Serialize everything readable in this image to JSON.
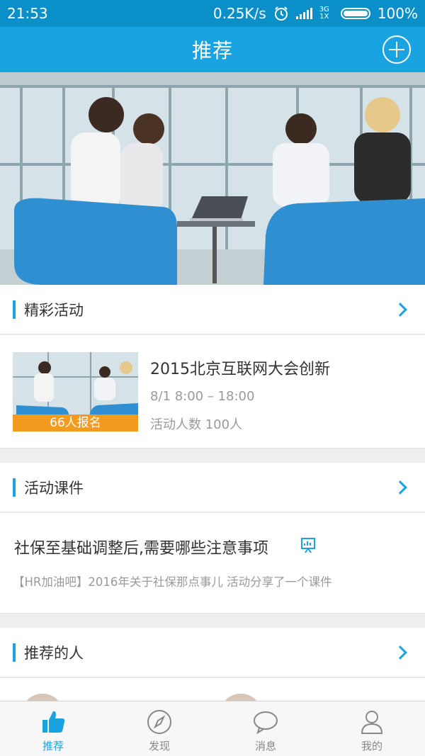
{
  "status_bar": {
    "time": "21:53",
    "speed": "0.25K/s",
    "network_top": "3G",
    "network_bottom": "1X",
    "battery": "100%"
  },
  "header": {
    "title": "推荐",
    "add_icon": "plus-circle-icon"
  },
  "sections": {
    "activities": {
      "title": "精彩活动"
    },
    "courseware": {
      "title": "活动课件"
    },
    "people": {
      "title": "推荐的人"
    }
  },
  "activity": {
    "title": "2015北京互联网大会创新",
    "time": "8/1  8:00 – 18:00",
    "count": "活动人数  100人",
    "badge": "66人报名"
  },
  "courseware_item": {
    "title": "社保至基础调整后,需要哪些注意事项",
    "desc": "【HR加油吧】2016年关于社保那点事儿  活动分享了一个课件",
    "icon": "presentation-icon"
  },
  "tabs": [
    {
      "label": "推荐",
      "icon": "thumbs-up-icon",
      "active": true
    },
    {
      "label": "发现",
      "icon": "compass-icon",
      "active": false
    },
    {
      "label": "消息",
      "icon": "chat-bubble-icon",
      "active": false
    },
    {
      "label": "我的",
      "icon": "person-icon",
      "active": false
    }
  ],
  "colors": {
    "status_bar": "#0b8fc8",
    "header": "#1aa3e1",
    "accent": "#1aa3e1",
    "badge": "#f39b1f"
  }
}
